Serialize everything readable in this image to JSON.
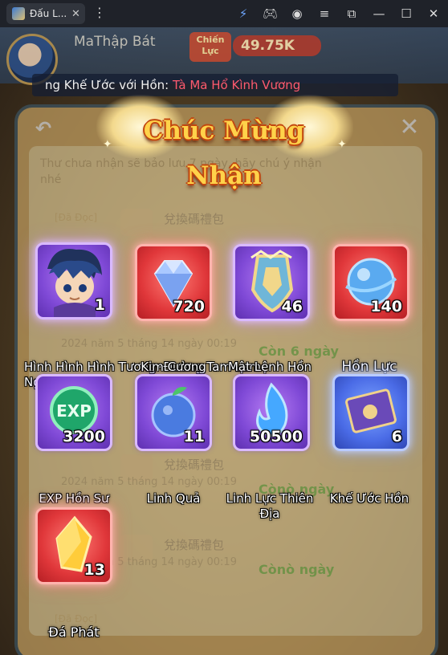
{
  "browser": {
    "tab_title": "Đấu L...",
    "tab_close": "✕"
  },
  "hud": {
    "player_name": "MaThập Bát",
    "power_label": "Chiến Lực",
    "power_value": "49.75K",
    "marquee_prefix": "ng Khế Ước với Hồn: ",
    "marquee_highlight": "Tà Ma Hổ Kình Vương"
  },
  "mail": {
    "note": "Thư chưa nhận sẽ bảo lưu 7 ngày, hãy chú ý nhận nhé",
    "rows": [
      {
        "tag": "[Đã Đọc]",
        "subject": "兌換碼禮包",
        "date": "",
        "remaining": ""
      },
      {
        "tag": "",
        "subject": "",
        "date": "2024 năm 5 tháng 14 ngày 00:19",
        "remaining": "Còn 6 ngày"
      },
      {
        "tag": "",
        "subject": "兌換碼禮包",
        "date": "2024 năm 5 tháng 14 ngày 00:19",
        "remaining": "Cònò ngày"
      },
      {
        "tag": "[Đã Đọc]",
        "subject": "兌換碼禮包",
        "date": "2024 năm 5 tháng 14 ngày 00:19",
        "remaining": "Cònò ngày"
      }
    ]
  },
  "banner": {
    "title": "Chúc Mừng Nhận"
  },
  "rewards": [
    {
      "name": "Hình Hình Hình Tương•Đường Tam Lam Ngân",
      "qty": "1",
      "rarity": "purple",
      "icon": "portrait-icon"
    },
    {
      "name": "Kim Cương",
      "qty": "720",
      "rarity": "red",
      "icon": "diamond-icon"
    },
    {
      "name": "Mật Lệnh Hồn Sư",
      "qty": "46",
      "rarity": "purple",
      "icon": "shield-token-icon"
    },
    {
      "name": "Hồn Lực",
      "qty": "140",
      "rarity": "red",
      "icon": "soul-orb-icon"
    },
    {
      "name": "EXP Hồn Sư",
      "qty": "3200",
      "rarity": "plain",
      "icon": "exp-coin-icon"
    },
    {
      "name": "Linh Quả",
      "qty": "11",
      "rarity": "plain",
      "icon": "spirit-fruit-icon"
    },
    {
      "name": "Linh Lực Thiên Địa",
      "qty": "50500",
      "rarity": "plain",
      "icon": "spirit-flame-icon"
    },
    {
      "name": "Khế Ước Hồn",
      "qty": "6",
      "rarity": "blue",
      "icon": "contract-ticket-icon"
    },
    {
      "name": "Đá Phát",
      "qty": "13",
      "rarity": "red",
      "icon": "crystal-icon"
    }
  ]
}
